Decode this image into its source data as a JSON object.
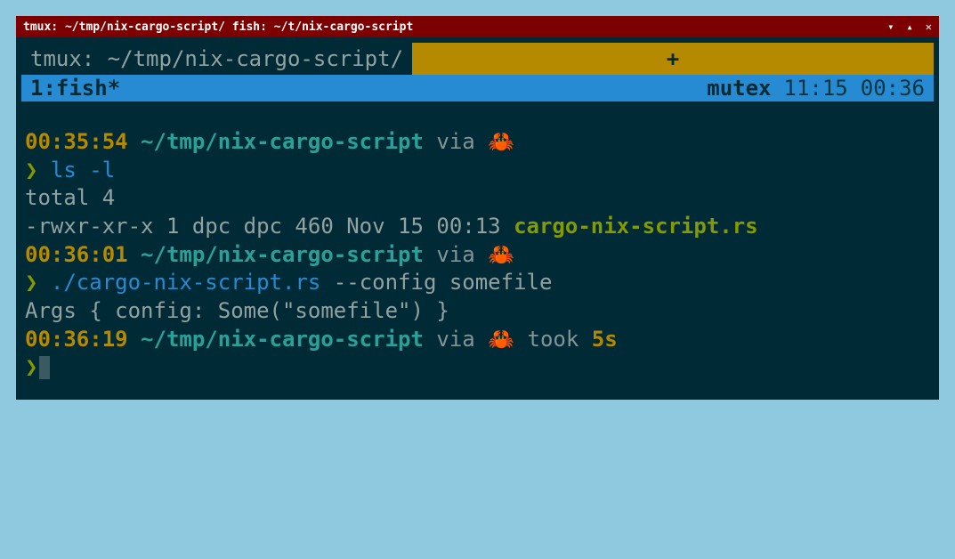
{
  "titlebar": {
    "text": "tmux: ~/tmp/nix-cargo-script/ fish: ~/t/nix-cargo-script"
  },
  "tabs": {
    "active_label": "tmux: ~/tmp/nix-cargo-script/",
    "new_tab_label": "+"
  },
  "statusbar": {
    "window": "1:fish*",
    "hostname": "mutex",
    "date": "11:15",
    "time": "00:36"
  },
  "lines": {
    "l1_time": "00:35:54",
    "l1_path": "~/tmp/nix-cargo-script",
    "l1_via": " via ",
    "l1_icon": "🦀",
    "l2_prompt": "❯",
    "l2_cmd": " ls -l",
    "l3": "total 4",
    "l4_perm": "-rwxr-xr-x 1 dpc dpc 460 Nov 15 00:13 ",
    "l4_file": "cargo-nix-script.rs",
    "l5_time": "00:36:01",
    "l5_path": "~/tmp/nix-cargo-script",
    "l5_via": " via ",
    "l5_icon": "🦀",
    "l6_prompt": "❯",
    "l6_cmd": " ./cargo-nix-script.rs",
    "l6_args": " --config somefile",
    "l7": "Args { config: Some(\"somefile\") }",
    "l8_time": "00:36:19",
    "l8_path": "~/tmp/nix-cargo-script",
    "l8_via": " via ",
    "l8_icon": "🦀",
    "l8_took": " took ",
    "l8_dur": "5s",
    "l9_prompt": "❯"
  }
}
